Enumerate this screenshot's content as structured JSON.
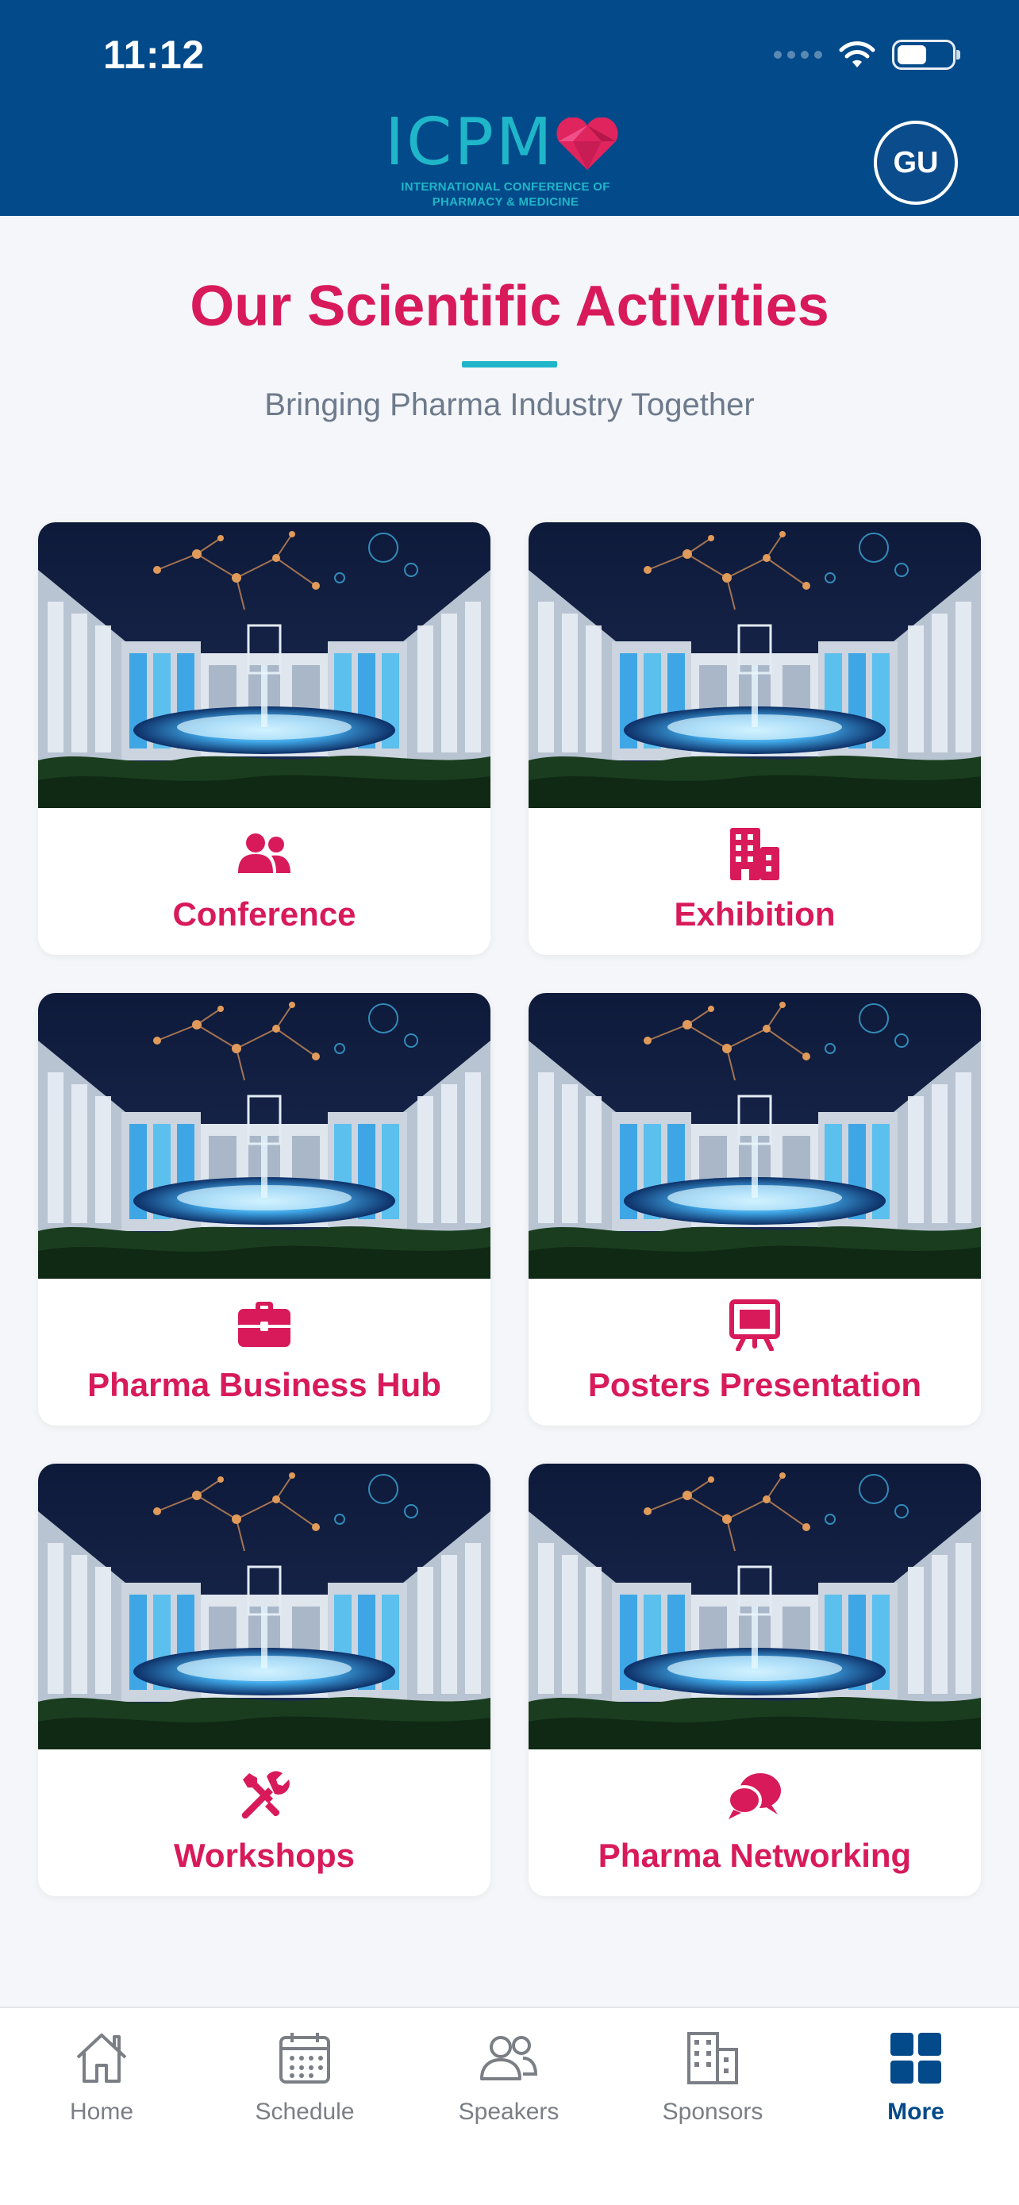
{
  "status_bar": {
    "time": "11:12"
  },
  "header": {
    "logo_text": "ICPM",
    "logo_subtitle_1": "INTERNATIONAL CONFERENCE OF",
    "logo_subtitle_2": "PHARMACY & MEDICINE",
    "avatar_initials": "GU"
  },
  "section": {
    "title": "Our Scientific Activities",
    "subtitle": "Bringing Pharma Industry Together"
  },
  "activities": [
    {
      "label": "Conference",
      "icon": "users-icon"
    },
    {
      "label": "Exhibition",
      "icon": "building-icon"
    },
    {
      "label": "Pharma Business Hub",
      "icon": "briefcase-icon"
    },
    {
      "label": "Posters Presentation",
      "icon": "easel-icon"
    },
    {
      "label": "Workshops",
      "icon": "tools-icon"
    },
    {
      "label": "Pharma Networking",
      "icon": "chat-bubbles-icon"
    }
  ],
  "tabbar": {
    "items": [
      {
        "label": "Home",
        "icon": "home-icon",
        "active": false
      },
      {
        "label": "Schedule",
        "icon": "calendar-icon",
        "active": false
      },
      {
        "label": "Speakers",
        "icon": "people-icon",
        "active": false
      },
      {
        "label": "Sponsors",
        "icon": "buildings-icon",
        "active": false
      },
      {
        "label": "More",
        "icon": "grid-icon",
        "active": true
      }
    ]
  },
  "colors": {
    "header_bg": "#034a8a",
    "accent_pink": "#d81a5b",
    "accent_teal": "#1fb6c9",
    "tab_active": "#034a8a"
  }
}
